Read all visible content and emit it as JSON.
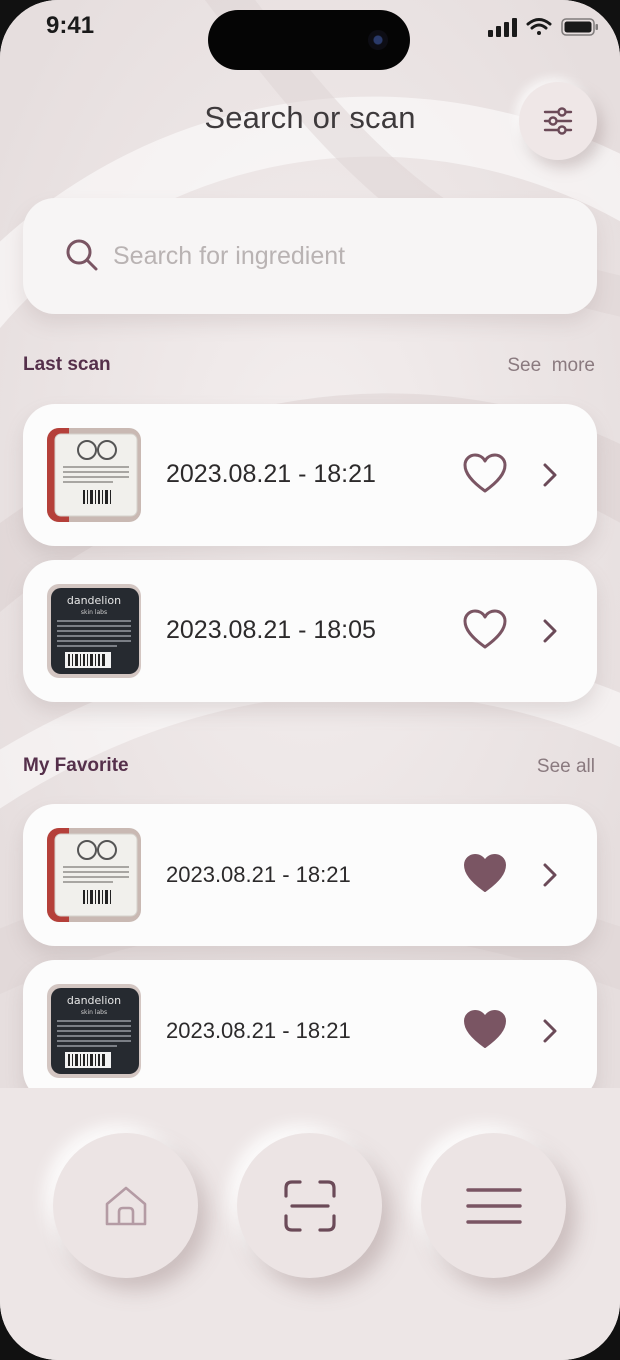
{
  "status_bar": {
    "time": "9:41"
  },
  "header": {
    "title": "Search or scan",
    "filter_icon": "sliders-icon"
  },
  "search": {
    "placeholder": "Search for ingredient",
    "value": "",
    "icon": "search-icon"
  },
  "last_scan": {
    "title": "Last scan",
    "link": "See  more",
    "items": [
      {
        "date": "2023.08.21 - 18:21",
        "favorite": false,
        "thumb": "white-product-label"
      },
      {
        "date": "2023.08.21 - 18:05",
        "favorite": false,
        "thumb": "dandelion-black-label"
      }
    ]
  },
  "favorites": {
    "title": "My Favorite",
    "link": "See all",
    "items": [
      {
        "date": "2023.08.21 - 18:21",
        "favorite": true,
        "thumb": "white-product-label"
      },
      {
        "date": "2023.08.21 - 18:21",
        "favorite": true,
        "thumb": "dandelion-black-label"
      }
    ]
  },
  "bottom_nav": [
    {
      "name": "home",
      "icon": "home-icon"
    },
    {
      "name": "scan",
      "icon": "scan-icon"
    },
    {
      "name": "menu",
      "icon": "menu-icon"
    }
  ],
  "thumb_text": {
    "brand": "dandelion",
    "sub": "skin labs"
  },
  "colors": {
    "accent": "#7a5563",
    "heading": "#55304b",
    "background": "#e9e3e3",
    "card": "#fcfcfc"
  }
}
